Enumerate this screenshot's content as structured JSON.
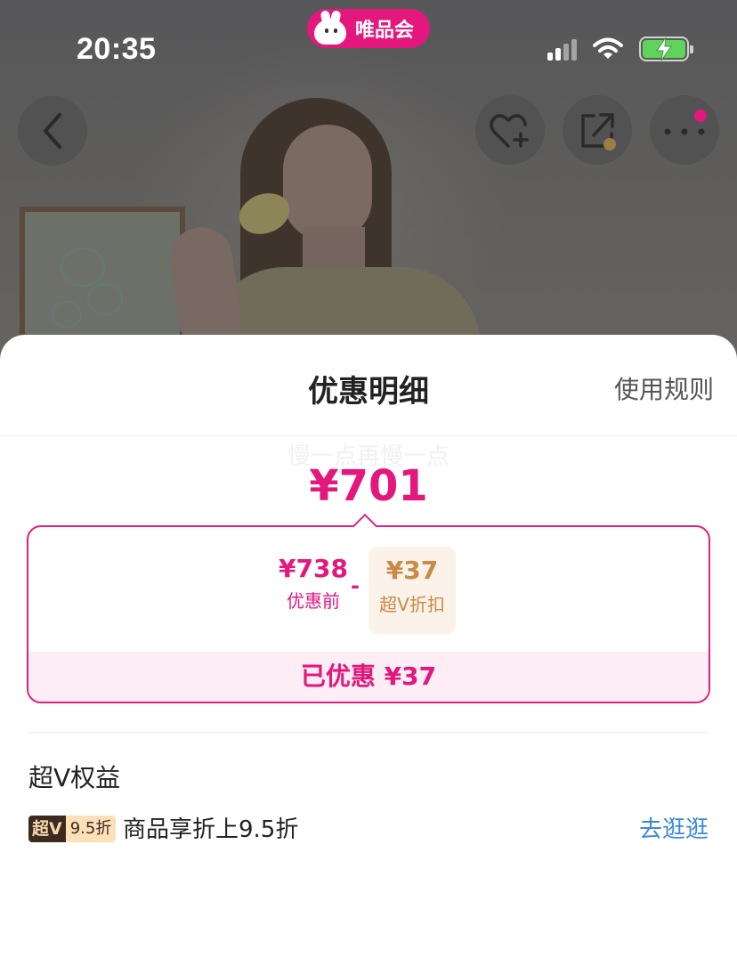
{
  "status_bar": {
    "time": "20:35",
    "app_pill_label": "唯品会"
  },
  "nav": {
    "back_icon": "chevron-left-icon",
    "favorite_icon": "heart-plus-icon",
    "share_icon": "share-icon",
    "more_icon": "more-dots-icon"
  },
  "sheet": {
    "title": "优惠明细",
    "rules_link": "使用规则",
    "watermark": "慢一点再慢一点",
    "final_price": "¥701",
    "breakdown": {
      "original_price": "¥738",
      "original_label": "优惠前",
      "operator": "-",
      "discount_price": "¥37",
      "discount_label": "超V折扣",
      "saved_text": "已优惠 ¥37"
    },
    "benefits": {
      "section_title": "超V权益",
      "badge_left": "超V",
      "badge_right": "9.5折",
      "description": "商品享折上9.5折",
      "action_link": "去逛逛"
    }
  },
  "colors": {
    "brand_pink": "#e4177c",
    "discount_gold": "#c98a45",
    "link_blue": "#3b8ad6"
  }
}
